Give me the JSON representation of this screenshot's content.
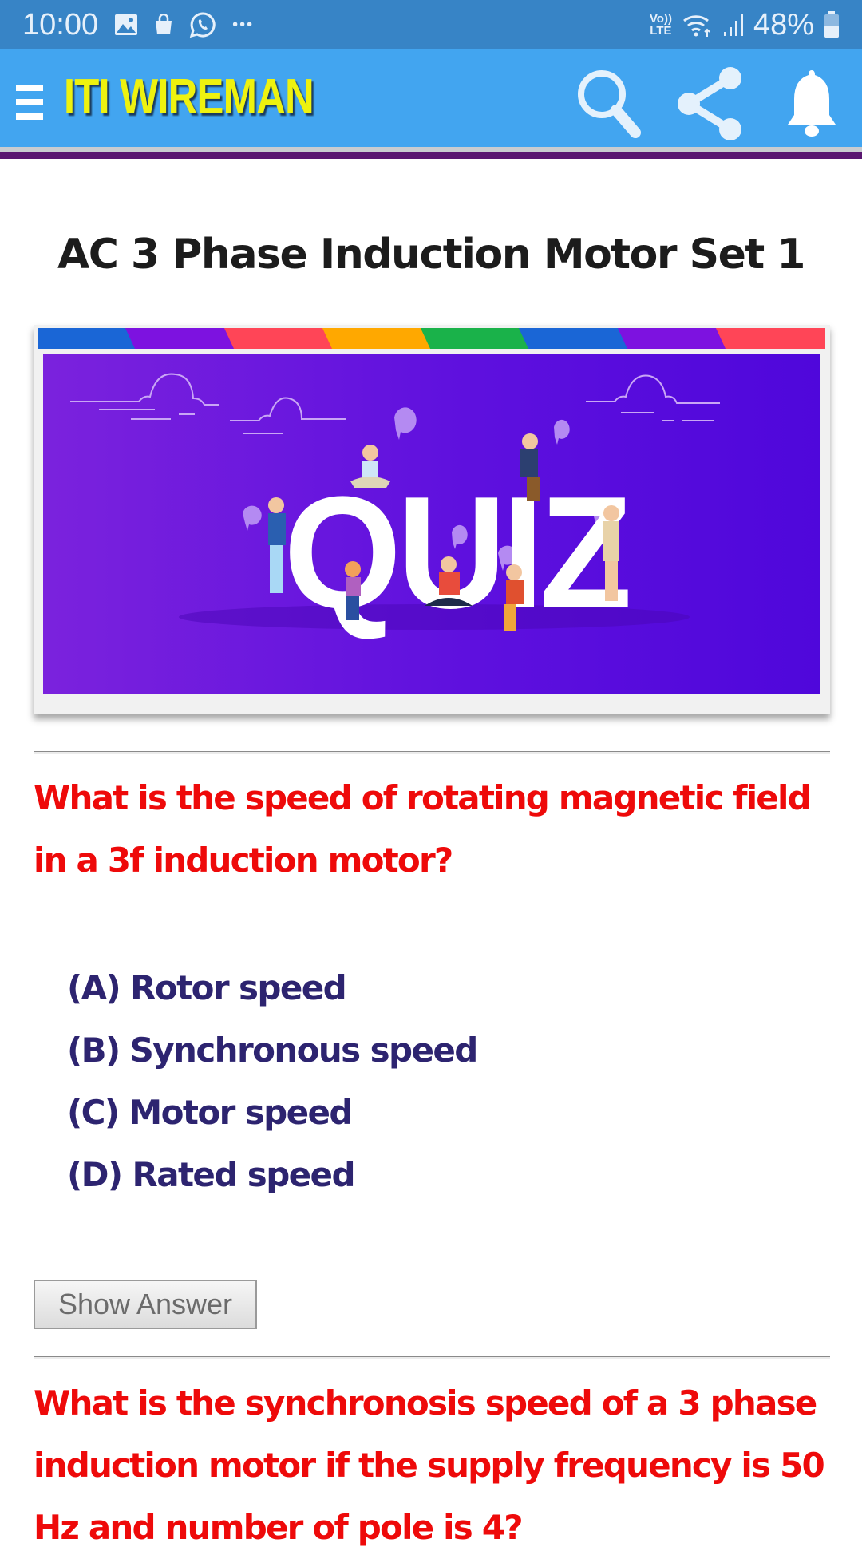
{
  "status_bar": {
    "time": "10:00",
    "left_icons": [
      "gallery-icon",
      "shopping-bag-icon",
      "whatsapp-icon",
      "more-dots-icon"
    ],
    "more": "•••",
    "network_label_top": "Vo))",
    "network_label_bottom": "LTE",
    "battery_percent": "48%",
    "battery_level": 0.48
  },
  "app_bar": {
    "title": "ITI WIREMAN",
    "icons": [
      "menu-icon",
      "search-icon",
      "share-icon",
      "bell-icon"
    ],
    "bar_color": "#42a5f0",
    "title_color": "#eef20f"
  },
  "page": {
    "title": "AC 3 Phase Induction Motor Set 1",
    "banner": {
      "word": "QUIZ",
      "stripe_colors": [
        "#1a66d6",
        "#7d12e0",
        "#ff4557",
        "#ffa800",
        "#1ab24a",
        "#1a66d6",
        "#7d12e0",
        "#ff4557"
      ]
    }
  },
  "questions": [
    {
      "text": "What is the speed of rotating magnetic field in a 3f induction motor?",
      "options": [
        "(A) Rotor speed",
        "(B) Synchronous speed",
        "(C) Motor speed",
        "(D) Rated speed"
      ],
      "show_answer_label": "Show Answer"
    },
    {
      "text": "What is the synchronosis speed of a 3 phase induction motor if the supply frequency is 50 Hz and number of pole is 4?"
    }
  ],
  "colors": {
    "question": "#ee0a0a",
    "option": "#2d2470"
  }
}
